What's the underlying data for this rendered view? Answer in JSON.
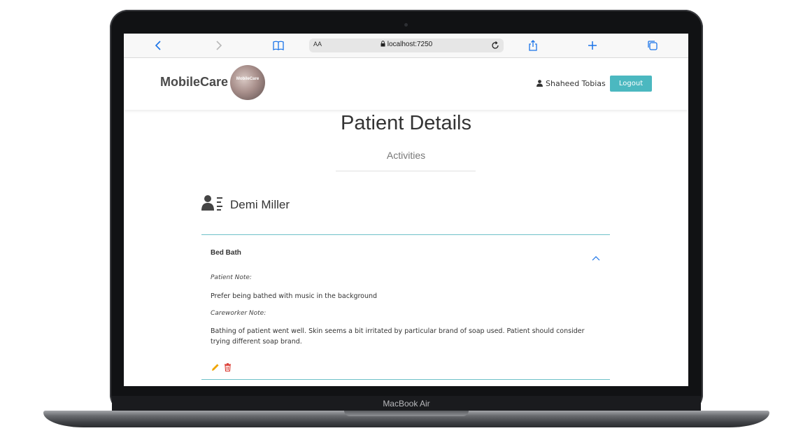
{
  "device": {
    "model_label": "MacBook Air"
  },
  "browser": {
    "text_size_label": "AA",
    "url": "localhost:7250",
    "icons": [
      "chevron-left-icon",
      "chevron-right-icon",
      "book-icon",
      "lock-icon",
      "reload-icon",
      "share-icon",
      "plus-icon",
      "tabs-icon"
    ]
  },
  "header": {
    "brand": "MobileCare",
    "logo_text": "MobileCare",
    "user_name": "Shaheed Tobias",
    "logout_label": "Logout"
  },
  "page": {
    "title": "Patient Details",
    "section": "Activities",
    "patient_name": "Demi Miller"
  },
  "activity": {
    "title": "Bed Bath",
    "patient_note_label": "Patient Note:",
    "patient_note": "Prefer being bathed with music in the background",
    "careworker_note_label": "Careworker Note:",
    "careworker_note": "Bathing of patient went well. Skin seems a bit irritated by particular brand of soap used. Patient should consider trying different soap brand."
  },
  "colors": {
    "accent": "#4bb8c0",
    "divider": "#6fc1c9",
    "edit": "#f0a500",
    "delete": "#d9342b",
    "browser_blue": "#1a73e8"
  }
}
